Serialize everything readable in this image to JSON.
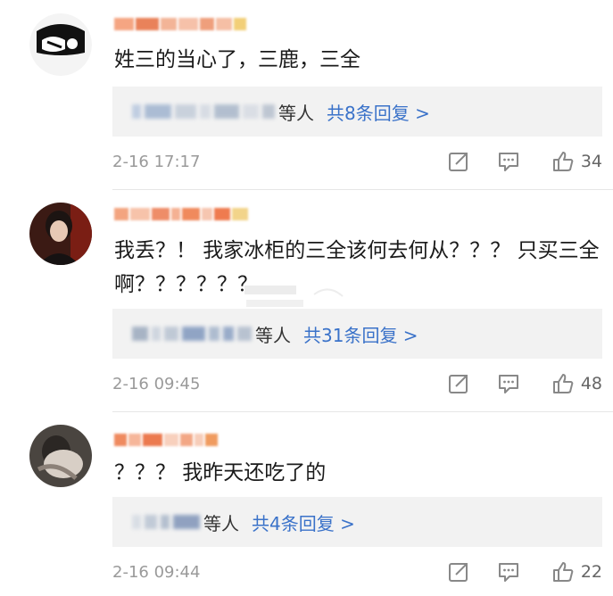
{
  "comments": [
    {
      "content": "姓三的当心了，三鹿，三全",
      "reply_suffix": "等人",
      "reply_link": "共8条回复 >",
      "timestamp": "2-16 17:17",
      "likes": "34"
    },
    {
      "content": "我丢？！ 我家冰柜的三全该何去何从？？？ 只买三全啊？？？？？？",
      "reply_suffix": "等人",
      "reply_link": "共31条回复 >",
      "timestamp": "2-16 09:45",
      "likes": "48"
    },
    {
      "content": "？？？ 我昨天还吃了的",
      "reply_suffix": "等人",
      "reply_link": "共4条回复 >",
      "timestamp": "2-16 09:44",
      "likes": "22"
    }
  ],
  "colors": {
    "link": "#3a72c9",
    "reply_bg": "#f2f2f2",
    "timestamp": "#9a9a9a",
    "username_blur": "#f08a5d"
  },
  "icons": [
    "share-icon",
    "comment-icon",
    "like-icon"
  ]
}
